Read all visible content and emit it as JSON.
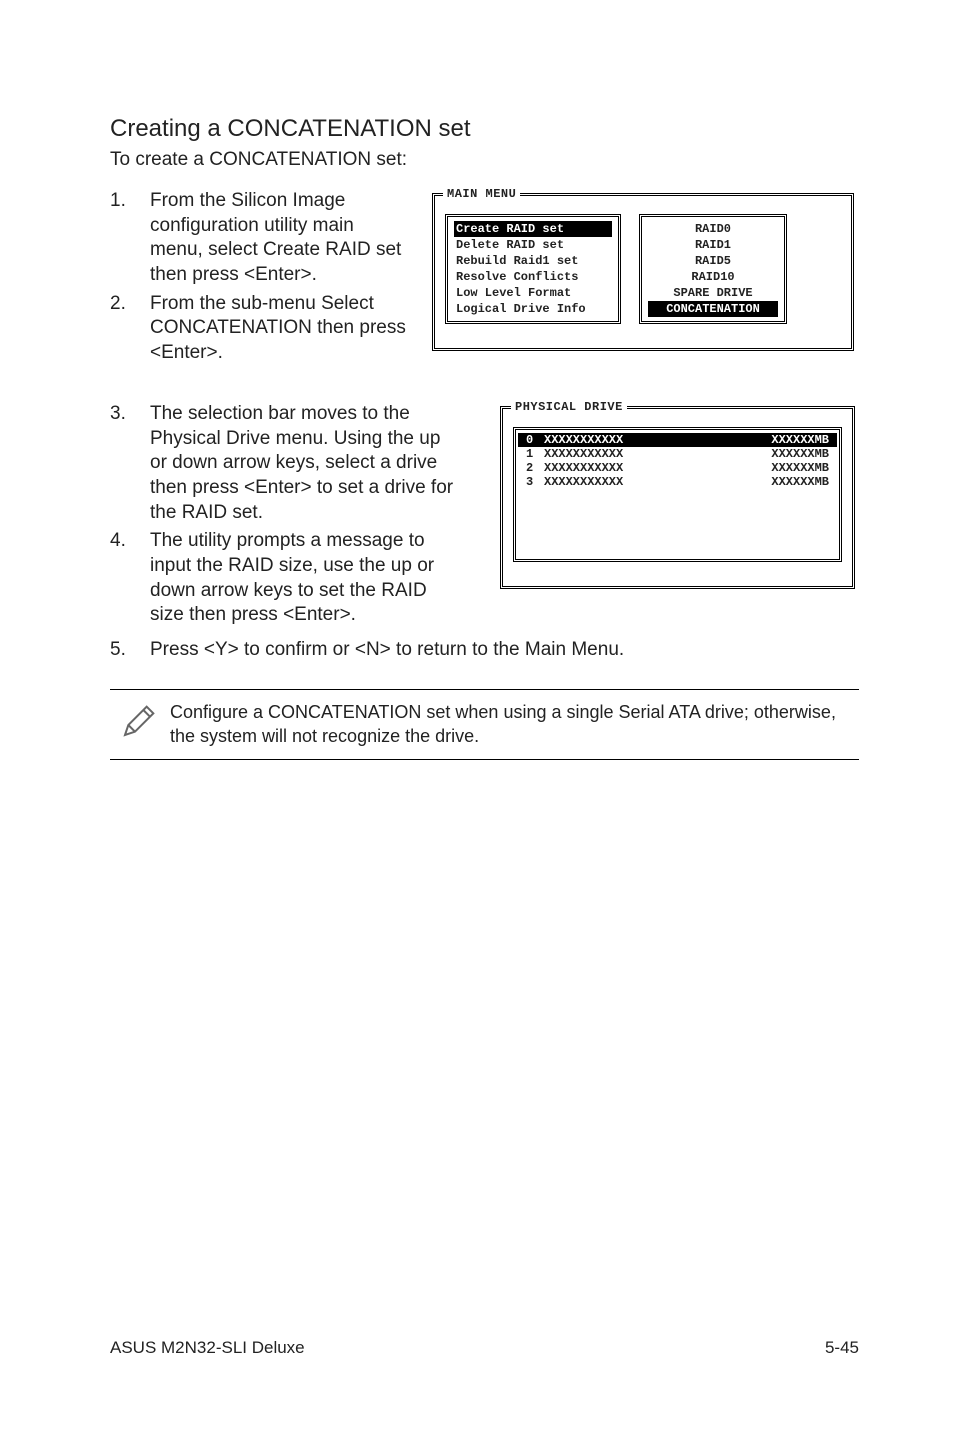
{
  "heading": "Creating a CONCATENATION set",
  "subtitle": "To create a CONCATENATION set:",
  "steps": [
    {
      "num": "1.",
      "text": "From the Silicon Image configuration utility main menu, select Create RAID set then press <Enter>."
    },
    {
      "num": "2.",
      "text": "From the sub-menu Select CONCATENATION then press <Enter>."
    },
    {
      "num": "3.",
      "text": "The selection bar moves to the Physical Drive menu. Using the up or down arrow keys, select a drive then press <Enter> to set a drive for the RAID set."
    },
    {
      "num": "4.",
      "text": "The utility prompts a message to input the RAID size, use the up or down arrow keys to set the RAID size then press <Enter>."
    },
    {
      "num": "5.",
      "text": "Press <Y> to confirm or <N> to return to the Main Menu."
    }
  ],
  "bios1": {
    "legend": "MAIN MENU",
    "main_items": [
      "Create RAID set",
      "Delete RAID set",
      "Rebuild Raid1 set",
      "Resolve Conflicts",
      "Low Level Format",
      "Logical Drive Info"
    ],
    "raid_options": [
      "RAID0",
      "RAID1",
      "RAID5",
      "RAID10",
      "SPARE DRIVE",
      "CONCATENATION"
    ],
    "main_selected_index": 0,
    "raid_selected_index": 5
  },
  "bios2": {
    "legend": "PHYSICAL DRIVE",
    "drives": [
      {
        "idx": "0",
        "name": "XXXXXXXXXXX",
        "size": "XXXXXXMB"
      },
      {
        "idx": "1",
        "name": "XXXXXXXXXXX",
        "size": "XXXXXXMB"
      },
      {
        "idx": "2",
        "name": "XXXXXXXXXXX",
        "size": "XXXXXXMB"
      },
      {
        "idx": "3",
        "name": "XXXXXXXXXXX",
        "size": "XXXXXXMB"
      }
    ],
    "selected_index": 0
  },
  "note": "Configure a CONCATENATION set when using a single Serial ATA drive; otherwise, the system will not recognize the drive.",
  "footer_left": "ASUS M2N32-SLI Deluxe",
  "footer_right": "5-45"
}
